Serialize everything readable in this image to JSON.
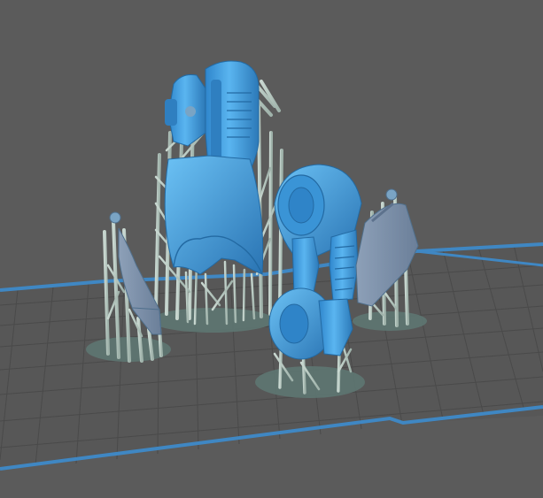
{
  "scene": {
    "background": "#5b5b5b",
    "plate": {
      "fill": "#575757",
      "grid": "#4a4a4a",
      "edge": "#3f87c3"
    },
    "support_color": "#b7c8c0",
    "model_color": "#4aa6e6",
    "model_shadow": "#2c7bbd",
    "model_alt_color": "#7f93ad",
    "objects": [
      {
        "name": "armor-torso",
        "part": "torso"
      },
      {
        "name": "armor-shoulder",
        "part": "shoulder"
      },
      {
        "name": "armor-small-plate-left",
        "part": "small-plate"
      },
      {
        "name": "armor-plate-right",
        "part": "plate"
      }
    ]
  }
}
